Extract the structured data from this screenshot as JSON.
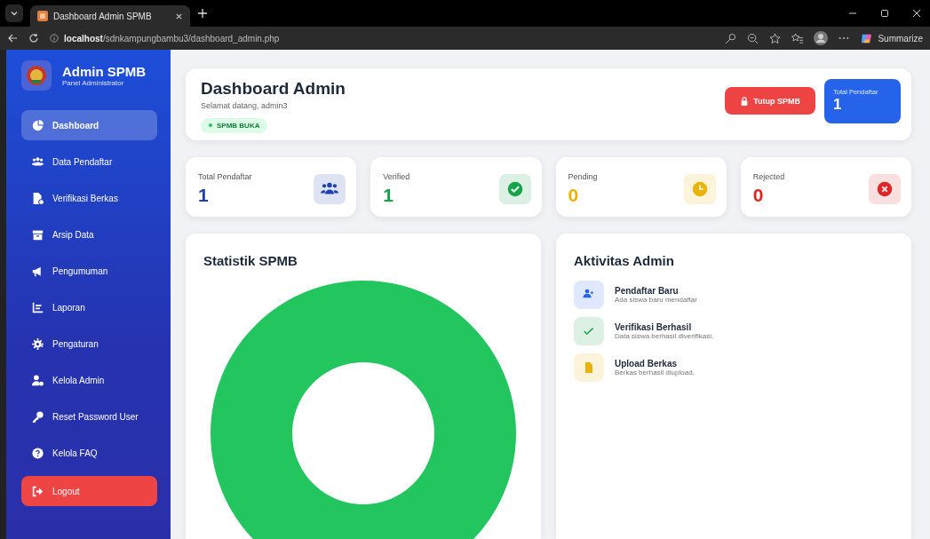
{
  "browser": {
    "tab_title": "Dashboard Admin SPMB",
    "url_host": "localhost",
    "url_path": "/sdnkampungbambu3/dashboard_admin.php",
    "summarize": "Summarize"
  },
  "sidebar": {
    "title": "Admin SPMB",
    "subtitle": "Panel Administrator",
    "items": [
      {
        "label": "Dashboard",
        "selected": true
      },
      {
        "label": "Data Pendaftar",
        "selected": false
      },
      {
        "label": "Verifikasi Berkas",
        "selected": false
      },
      {
        "label": "Arsip Data",
        "selected": false
      },
      {
        "label": "Pengumuman",
        "selected": false
      },
      {
        "label": "Laporan",
        "selected": false
      },
      {
        "label": "Pengaturan",
        "selected": false
      },
      {
        "label": "Kelola Admin",
        "selected": false
      },
      {
        "label": "Reset Password User",
        "selected": false
      },
      {
        "label": "Kelola FAQ",
        "selected": false
      }
    ],
    "logout": "Logout"
  },
  "header": {
    "title": "Dashboard Admin",
    "welcome": "Selamat datang, admin3",
    "status_badge": "SPMB BUKA",
    "close_button": "Tutup SPMB",
    "total_label": "Total Pendaftar",
    "total_value": "1"
  },
  "stats": [
    {
      "label": "Total Pendaftar",
      "value": "1",
      "color": "#1e40af"
    },
    {
      "label": "Verified",
      "value": "1",
      "color": "#16a34a"
    },
    {
      "label": "Pending",
      "value": "0",
      "color": "#eab308"
    },
    {
      "label": "Rejected",
      "value": "0",
      "color": "#dc2626"
    }
  ],
  "chart_panel": {
    "title": "Statistik SPMB"
  },
  "activity": {
    "title": "Aktivitas Admin",
    "items": [
      {
        "title": "Pendaftar Baru",
        "text": "Ada siswa baru mendaftar",
        "color": "#2563eb"
      },
      {
        "title": "Verifikasi Berhasil",
        "text": "Data siswa berhasil diverifikasi.",
        "color": "#16a34a"
      },
      {
        "title": "Upload Berkas",
        "text": "Berkas berhasil diupload.",
        "color": "#eab308"
      }
    ]
  }
}
